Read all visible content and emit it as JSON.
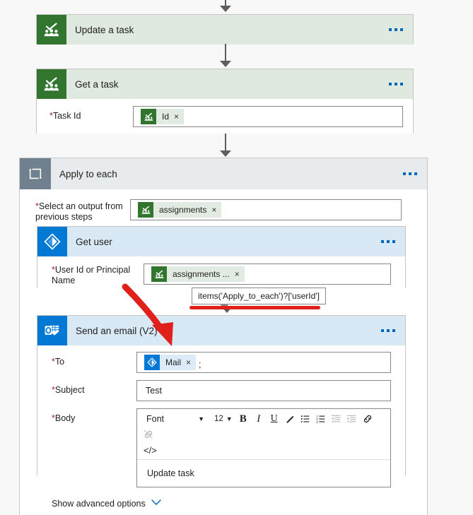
{
  "flow": {
    "steps": [
      {
        "id": "update-a-task",
        "title": "Update a task",
        "icon": "planner-icon",
        "theme": "green",
        "menu": "more-options"
      },
      {
        "id": "get-a-task",
        "title": "Get a task",
        "icon": "planner-icon",
        "theme": "green",
        "menu": "more-options",
        "fields": [
          {
            "label": "Task Id",
            "required": true,
            "token": {
              "text": "Id",
              "icon": "planner-icon",
              "remove": "×"
            }
          }
        ]
      },
      {
        "id": "apply-to-each",
        "title": "Apply to each",
        "icon": "loop-icon",
        "theme": "grey",
        "menu": "more-options",
        "fields": [
          {
            "label": "Select an output from previous steps",
            "required": true,
            "token": {
              "text": "assignments",
              "icon": "planner-icon",
              "remove": "×"
            }
          }
        ]
      },
      {
        "id": "get-user",
        "title": "Get user",
        "icon": "azure-ad-icon",
        "theme": "blue",
        "menu": "more-options",
        "fields": [
          {
            "label": "User Id or Principal Name",
            "required": true,
            "token": {
              "text": "assignments ...",
              "icon": "planner-icon",
              "remove": "×"
            }
          }
        ]
      },
      {
        "id": "send-an-email-v2",
        "title": "Send an email (V2)",
        "icon": "outlook-icon",
        "theme": "blue",
        "menu": "more-options",
        "fields": [
          {
            "label": "To",
            "required": true,
            "token": {
              "text": "Mail",
              "icon": "azure-ad-icon",
              "remove": "×"
            },
            "trailing": ";"
          },
          {
            "label": "Subject",
            "required": true,
            "value": "Test"
          },
          {
            "label": "Body",
            "required": true
          }
        ],
        "advanced_options_label": "Show advanced options",
        "advanced_options_chevron": "⌄"
      }
    ]
  },
  "editor": {
    "font_label": "Font",
    "font_caret": "▼",
    "size_label": "12",
    "size_caret": "▼",
    "buttons": [
      {
        "name": "bold-icon",
        "glyph": "B"
      },
      {
        "name": "italic-icon",
        "glyph": "I"
      },
      {
        "name": "underline-icon",
        "glyph": "U"
      },
      {
        "name": "text-color-icon",
        "glyph": "✒"
      },
      {
        "name": "bulleted-list-icon",
        "glyph": "☰"
      },
      {
        "name": "numbered-list-icon",
        "glyph": "☰"
      },
      {
        "name": "decrease-indent-icon",
        "glyph": "≡",
        "disabled": true
      },
      {
        "name": "increase-indent-icon",
        "glyph": "≡",
        "disabled": true
      },
      {
        "name": "insert-link-icon",
        "glyph": "🔗"
      },
      {
        "name": "remove-link-icon",
        "glyph": "🔗",
        "disabled": true
      }
    ],
    "code_view_label": "</>",
    "body_text": "Update task"
  },
  "annotation": {
    "tooltip_text": "items('Apply_to_each')?['userId']",
    "highlight_color": "#e0201b",
    "arrow_color": "#e0201b"
  },
  "colors": {
    "planner_green": "#31752f",
    "planner_header": "#dfe9df",
    "azure_blue": "#0078d4",
    "blue_header": "#d9e8f5",
    "loop_grey": "#70808f",
    "grey_header": "#e8ebee",
    "required_red": "#a4262c",
    "link_blue": "#0067b8"
  }
}
